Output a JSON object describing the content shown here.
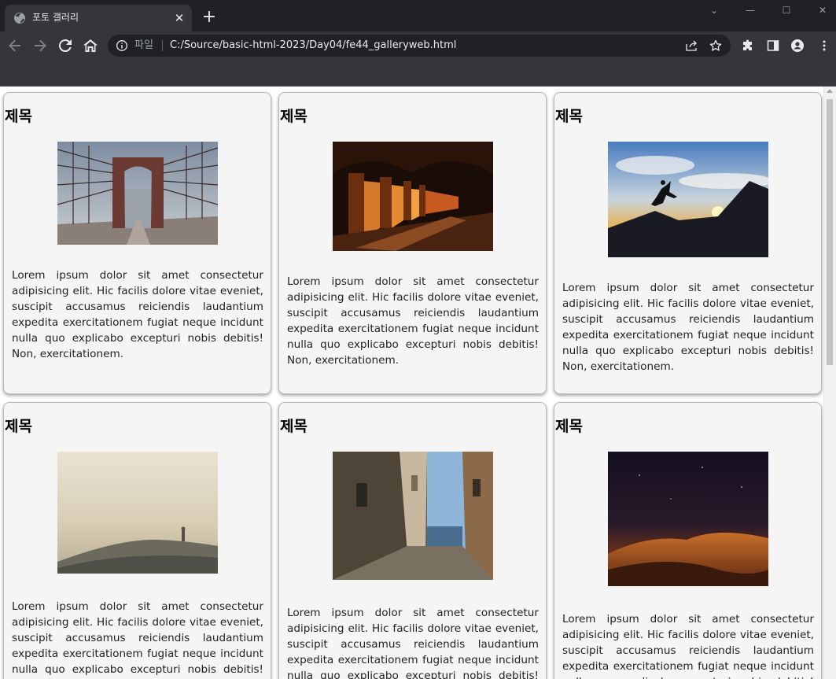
{
  "browser": {
    "tab_title": "포토 갤러리",
    "tab_close": "✕",
    "new_tab": "+",
    "window_controls": {
      "tab_search": "⌄",
      "minimize": "—",
      "maximize": "☐",
      "close": "✕"
    },
    "address_scheme": "파일",
    "address_url": "C:/Source/basic-html-2023/Day04/fe44_galleryweb.html",
    "icons": [
      "globe-icon",
      "back-arrow-icon",
      "forward-arrow-icon",
      "reload-icon",
      "home-icon",
      "info-icon",
      "share-icon",
      "star-icon",
      "puzzle-icon",
      "side-panel-icon",
      "profile-icon",
      "more-vert-icon"
    ]
  },
  "gallery": {
    "cards": [
      {
        "title": "제목",
        "image": "brooklyn-bridge-photo",
        "text": "Lorem ipsum dolor sit amet consectetur adipisicing elit. Hic facilis dolore vitae eveniet, suscipit accusamus reiciendis laudantium expedita exercitationem fugiat neque incidunt nulla quo explicabo excepturi nobis debitis! Non, exercitationem."
      },
      {
        "title": "제목",
        "image": "arched-corridor-photo",
        "text": "Lorem ipsum dolor sit amet consectetur adipisicing elit. Hic facilis dolore vitae eveniet, suscipit accusamus reiciendis laudantium expedita exercitationem fugiat neque incidunt nulla quo explicabo excepturi nobis debitis! Non, exercitationem."
      },
      {
        "title": "제목",
        "image": "sunset-jump-photo",
        "text": "Lorem ipsum dolor sit amet consectetur adipisicing elit. Hic facilis dolore vitae eveniet, suscipit accusamus reiciendis laudantium expedita exercitationem fugiat neque incidunt nulla quo explicabo excepturi nobis debitis! Non, exercitationem."
      },
      {
        "title": "제목",
        "image": "foggy-hill-photo",
        "text": "Lorem ipsum dolor sit amet consectetur adipisicing elit. Hic facilis dolore vitae eveniet, suscipit accusamus reiciendis laudantium expedita exercitationem fugiat neque incidunt nulla quo explicabo excepturi nobis debitis! Non, exercitationem."
      },
      {
        "title": "제목",
        "image": "sea-alley-photo",
        "text": "Lorem ipsum dolor sit amet consectetur adipisicing elit. Hic facilis dolore vitae eveniet, suscipit accusamus reiciendis laudantium expedita exercitationem fugiat neque incidunt nulla quo explicabo excepturi nobis debitis! Non, exercitationem."
      },
      {
        "title": "제목",
        "image": "desert-night-photo",
        "text": "Lorem ipsum dolor sit amet consectetur adipisicing elit. Hic facilis dolore vitae eveniet, suscipit accusamus reiciendis laudantium expedita exercitationem fugiat neque incidunt nulla quo explicabo excepturi nobis debitis! Non, exercitationem."
      }
    ]
  }
}
